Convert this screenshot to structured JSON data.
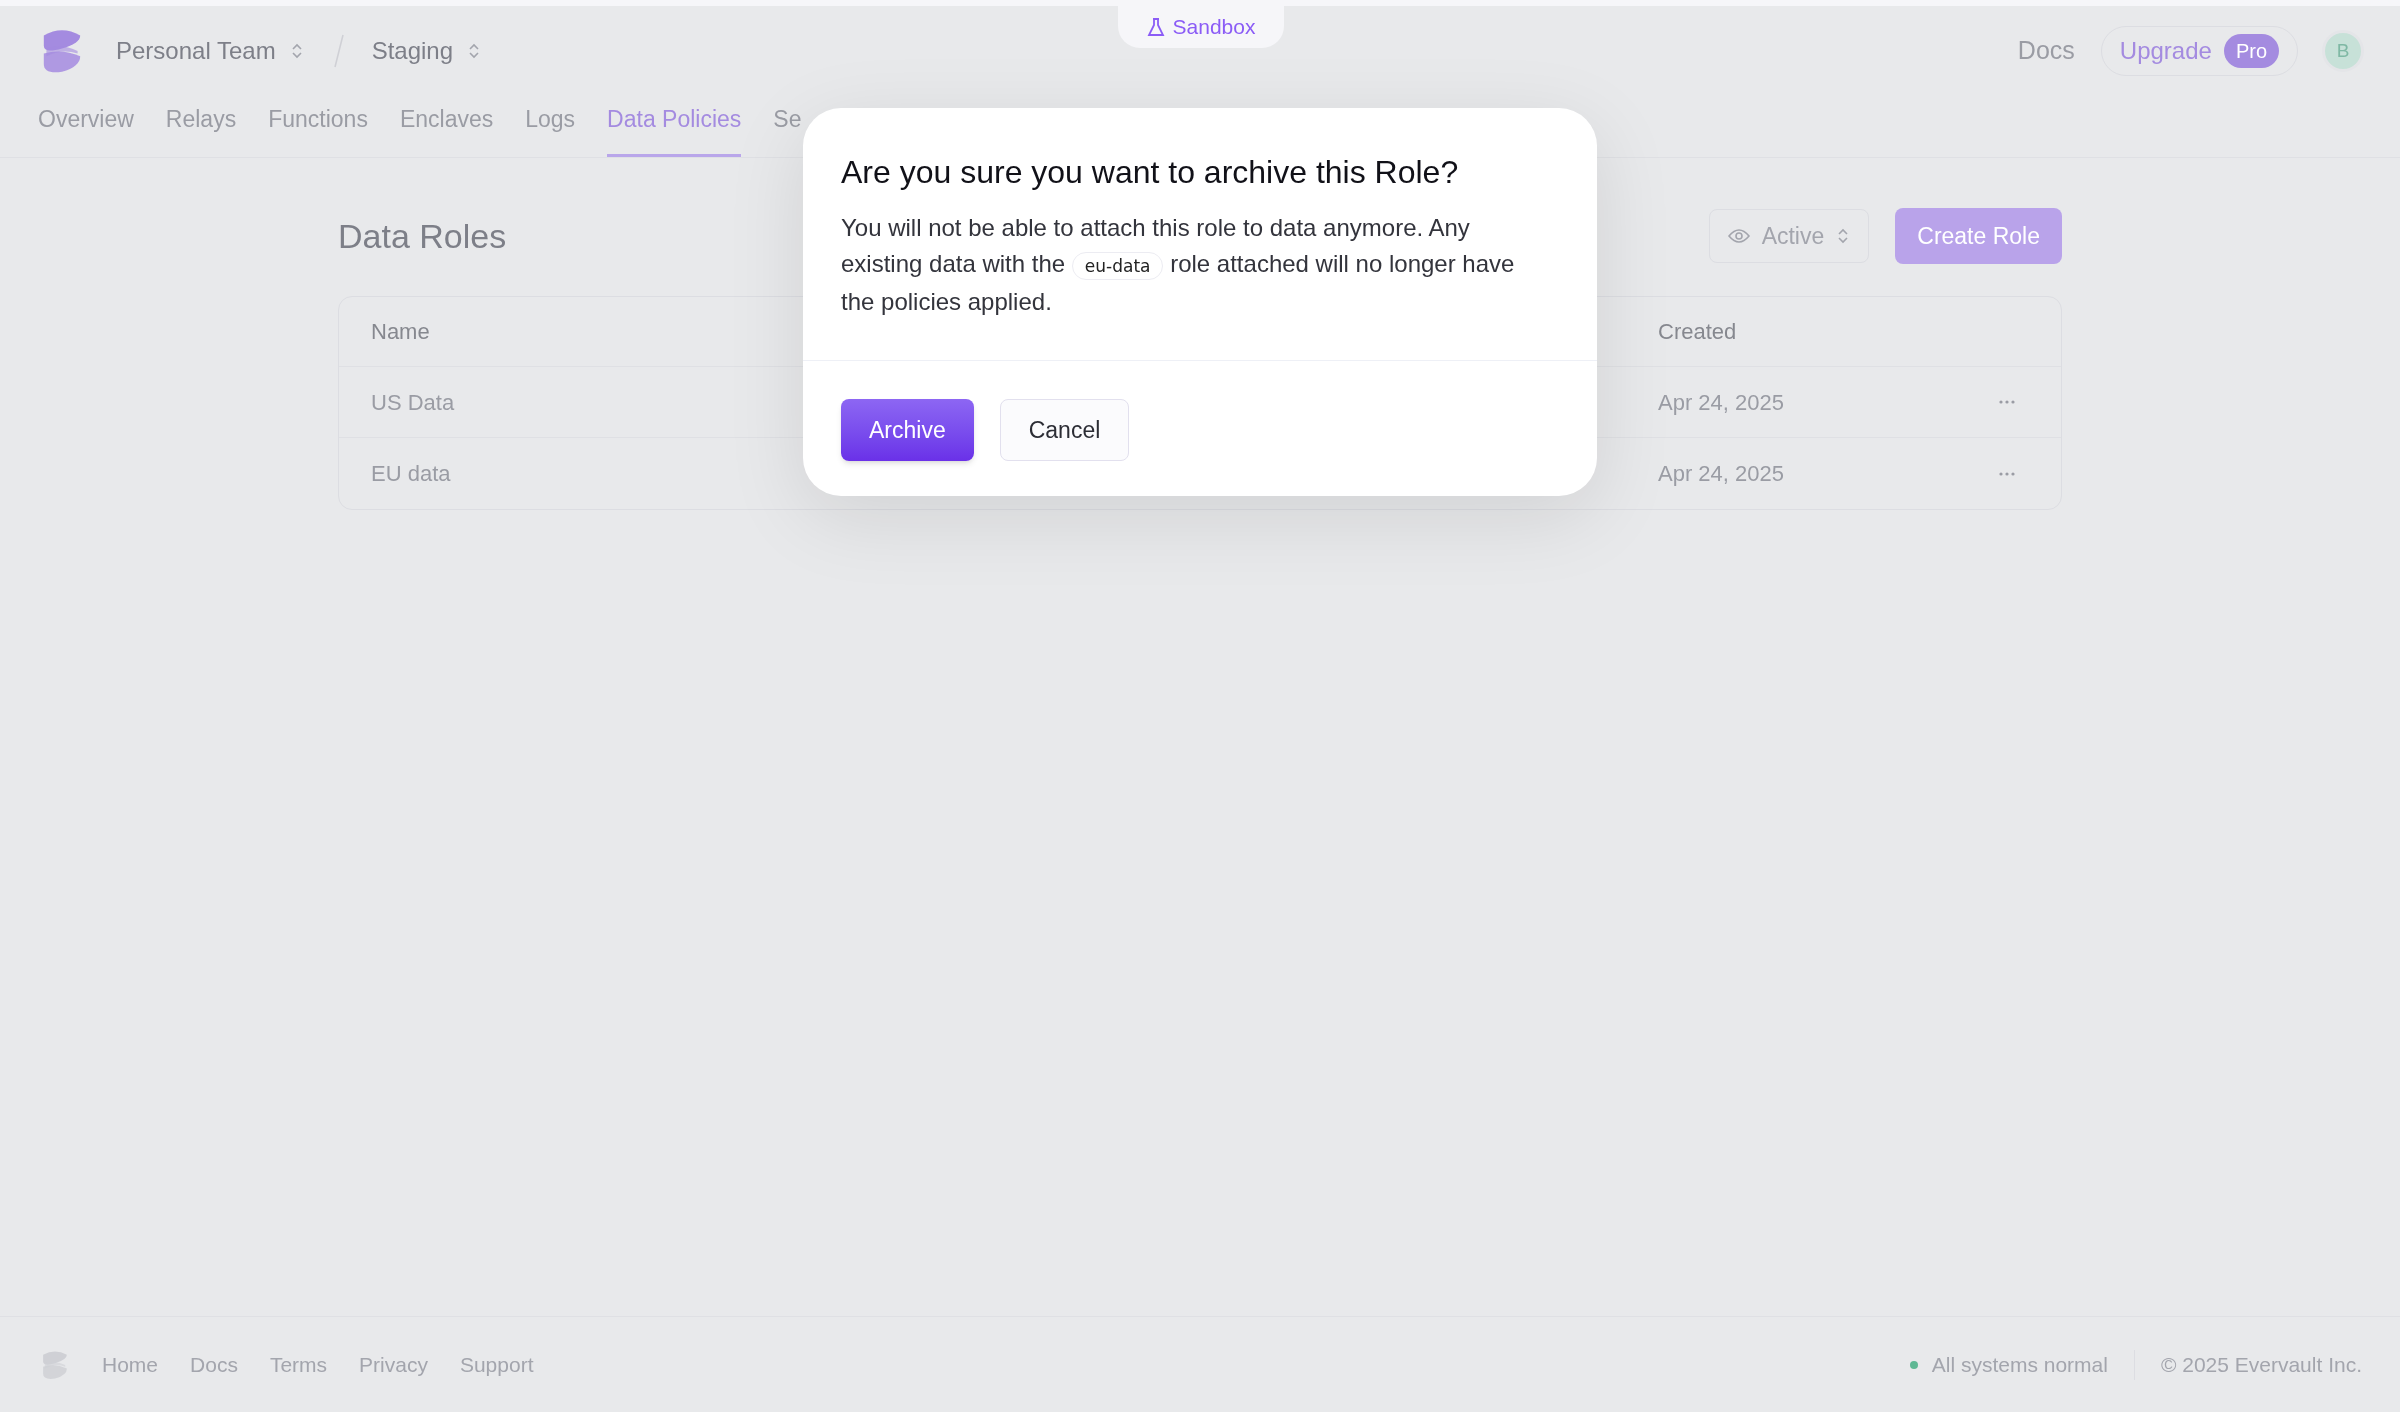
{
  "header": {
    "team": "Personal Team",
    "environment": "Staging",
    "sandbox": "Sandbox",
    "docs": "Docs",
    "upgrade": "Upgrade",
    "plan_badge": "Pro",
    "avatar": "B"
  },
  "tabs": [
    {
      "label": "Overview",
      "selected": false
    },
    {
      "label": "Relays",
      "selected": false
    },
    {
      "label": "Functions",
      "selected": false
    },
    {
      "label": "Enclaves",
      "selected": false
    },
    {
      "label": "Logs",
      "selected": false
    },
    {
      "label": "Data Policies",
      "selected": true
    },
    {
      "label": "Se",
      "selected": false
    }
  ],
  "page": {
    "title": "Data Roles",
    "filter": "Active",
    "create_button": "Create Role"
  },
  "table": {
    "columns": [
      "Name",
      "Created"
    ],
    "rows": [
      {
        "name": "US Data",
        "created": "Apr 24, 2025"
      },
      {
        "name": "EU data",
        "created": "Apr 24, 2025"
      }
    ]
  },
  "dialog": {
    "title": "Are you sure you want to archive this Role?",
    "text_before": "You will not be able to attach this role to data anymore. Any existing data with the",
    "role_tag": "eu-data",
    "text_after": "role attached will no longer have the policies applied.",
    "confirm": "Archive",
    "cancel": "Cancel"
  },
  "footer": {
    "links": [
      "Home",
      "Docs",
      "Terms",
      "Privacy",
      "Support"
    ],
    "status": {
      "text": "All systems normal",
      "color": "#5fb894"
    },
    "copyright": "© 2025 Evervault Inc."
  }
}
